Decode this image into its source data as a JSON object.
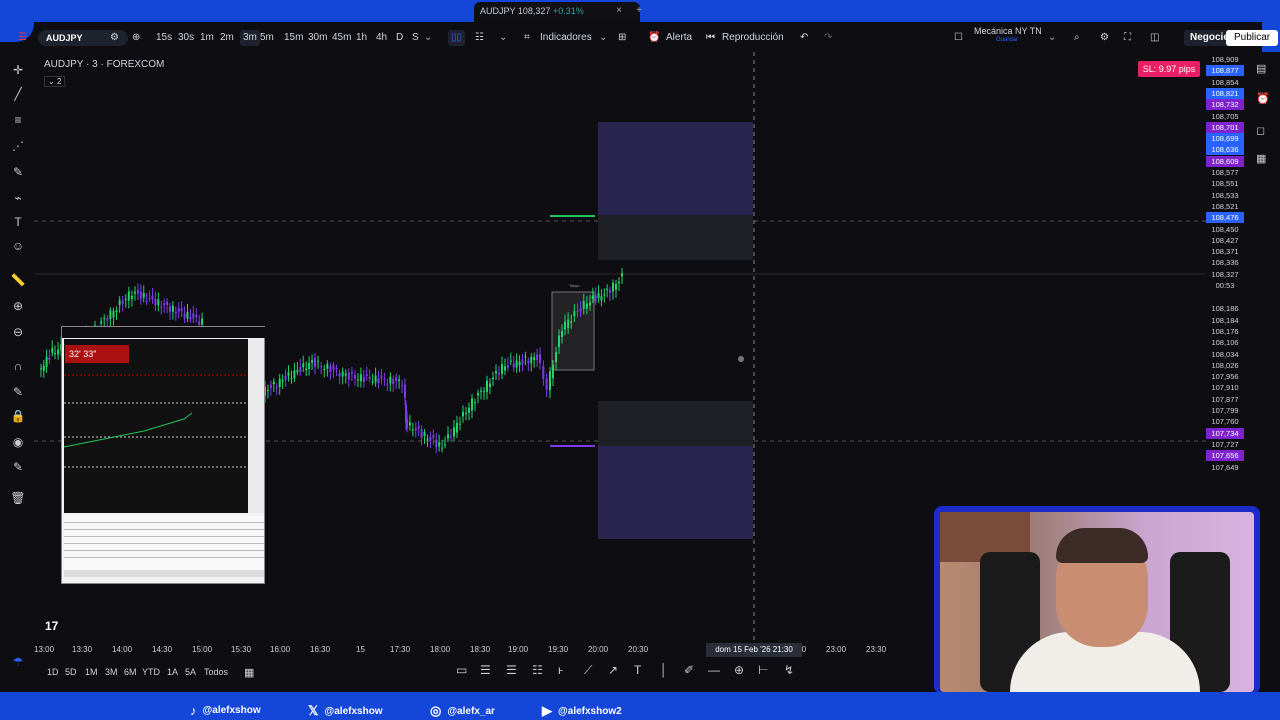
{
  "window_tab": {
    "title": "AUDJPY",
    "price": "108,327",
    "change": "+0.31%",
    "close": "×",
    "new": "+"
  },
  "toolbar": {
    "symbol": "AUDJPY",
    "intervals": [
      "15s",
      "30s",
      "1m",
      "2m",
      "3m",
      "5m",
      "15m",
      "30m",
      "45m",
      "1h",
      "4h",
      "D",
      "S"
    ],
    "active_interval": "3m",
    "indicators_label": "Indicadores",
    "alert_label": "Alerta",
    "replay_label": "Reproducción",
    "layout_name": "Mecánica NY TN",
    "layout_sub": "Guardar",
    "trade_label": "Negocie",
    "publish_label": "Publicar"
  },
  "chart": {
    "symbol_title": "AUDJPY · 3 · FOREXCOM",
    "indicator_count": "2",
    "sl_badge": "SL: 9.97 pips",
    "price_labels": [
      {
        "text": "108,909",
        "style": "plain"
      },
      {
        "text": "108,877",
        "style": "blue"
      },
      {
        "text": "108,854",
        "style": "plain"
      },
      {
        "text": "108,821",
        "style": "blue"
      },
      {
        "text": "108,732",
        "style": "purple"
      },
      {
        "text": "108,705",
        "style": "plain"
      },
      {
        "text": "108,701",
        "style": "purple"
      },
      {
        "text": "108,699",
        "style": "blue"
      },
      {
        "text": "108,636",
        "style": "blue"
      },
      {
        "text": "108,609",
        "style": "purple"
      },
      {
        "text": "108,577",
        "style": "plain"
      },
      {
        "text": "108,551",
        "style": "plain"
      },
      {
        "text": "108,533",
        "style": "plain"
      },
      {
        "text": "108,521",
        "style": "plain"
      },
      {
        "text": "108,476",
        "style": "blue"
      },
      {
        "text": "108,450",
        "style": "plain"
      },
      {
        "text": "108,427",
        "style": "plain"
      },
      {
        "text": "108,371",
        "style": "plain"
      },
      {
        "text": "108,336",
        "style": "plain"
      },
      {
        "text": "108,327",
        "style": "plain"
      },
      {
        "text": "00:53",
        "style": "plain"
      },
      {
        "text": "108,186",
        "style": "plain"
      },
      {
        "text": "108,184",
        "style": "plain"
      },
      {
        "text": "108,176",
        "style": "plain"
      },
      {
        "text": "108,106",
        "style": "plain"
      },
      {
        "text": "108,034",
        "style": "plain"
      },
      {
        "text": "108,026",
        "style": "plain"
      },
      {
        "text": "107,956",
        "style": "plain"
      },
      {
        "text": "107,910",
        "style": "plain"
      },
      {
        "text": "107,877",
        "style": "plain"
      },
      {
        "text": "107,799",
        "style": "plain"
      },
      {
        "text": "107,760",
        "style": "plain"
      },
      {
        "text": "107,734",
        "style": "purple"
      },
      {
        "text": "107,727",
        "style": "plain"
      },
      {
        "text": "107,656",
        "style": "purple"
      },
      {
        "text": "107,649",
        "style": "plain"
      }
    ],
    "time_labels": [
      "13:00",
      "13:30",
      "14:00",
      "14:30",
      "15:00",
      "15:30",
      "16:00",
      "16:30",
      "15",
      "17:30",
      "18:00",
      "18:30",
      "19:00",
      "19:30",
      "20:00",
      "20:30",
      "22:30",
      "23:00",
      "23:30"
    ],
    "crosshair_time": "dom 15 Feb '26  21:30",
    "session_label": "Tokyo",
    "colors": {
      "bull": "#22d46a",
      "bear": "#7c3aed",
      "box": "#2a2550",
      "line_green": "#22c55e",
      "line_purple": "#7c3aed"
    }
  },
  "bottom": {
    "ranges": [
      "1D",
      "5D",
      "1M",
      "3M",
      "6M",
      "YTD",
      "1A",
      "5A",
      "Todos"
    ],
    "logo": "17"
  },
  "mt_panel": {
    "timer": "32' 33\""
  },
  "social": [
    {
      "icon": "tiktok-icon",
      "glyph": "♪",
      "handle": "@alefxshow"
    },
    {
      "icon": "x-icon",
      "glyph": "𝕏",
      "handle": "@alefxshow"
    },
    {
      "icon": "instagram-icon",
      "glyph": "◎",
      "handle": "@alefx_ar"
    },
    {
      "icon": "youtube-icon",
      "glyph": "▶",
      "handle": "@alefxshow2"
    }
  ]
}
